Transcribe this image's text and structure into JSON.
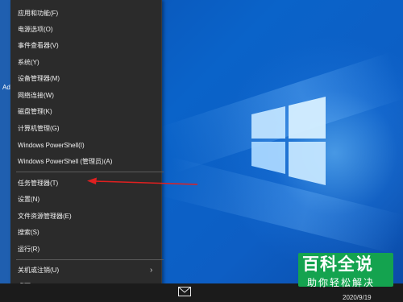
{
  "desktop": {
    "left_label": "Ad"
  },
  "context_menu": {
    "items_group1": [
      "应用和功能(F)",
      "电源选项(O)",
      "事件查看器(V)",
      "系统(Y)",
      "设备管理器(M)",
      "网络连接(W)",
      "磁盘管理(K)",
      "计算机管理(G)",
      "Windows PowerShell(I)",
      "Windows PowerShell (管理员)(A)"
    ],
    "items_group2": [
      "任务管理器(T)",
      "设置(N)",
      "文件资源管理器(E)",
      "搜索(S)",
      "运行(R)"
    ],
    "items_group3": [
      "关机或注销(U)",
      "桌面(D)"
    ],
    "highlighted_item": "任务管理器(T)"
  },
  "taskbar": {
    "date": "2020/9/19"
  },
  "watermark": {
    "line1": "百科全说",
    "line2": "助你轻松解决"
  },
  "colors": {
    "menu_bg": "#2b2b2b",
    "arrow": "#e02020",
    "watermark_bg": "#14a34f",
    "desktop": "#0a5ec4"
  },
  "icons": [
    "windows-logo-icon",
    "mail-icon",
    "chevron-right-icon"
  ]
}
